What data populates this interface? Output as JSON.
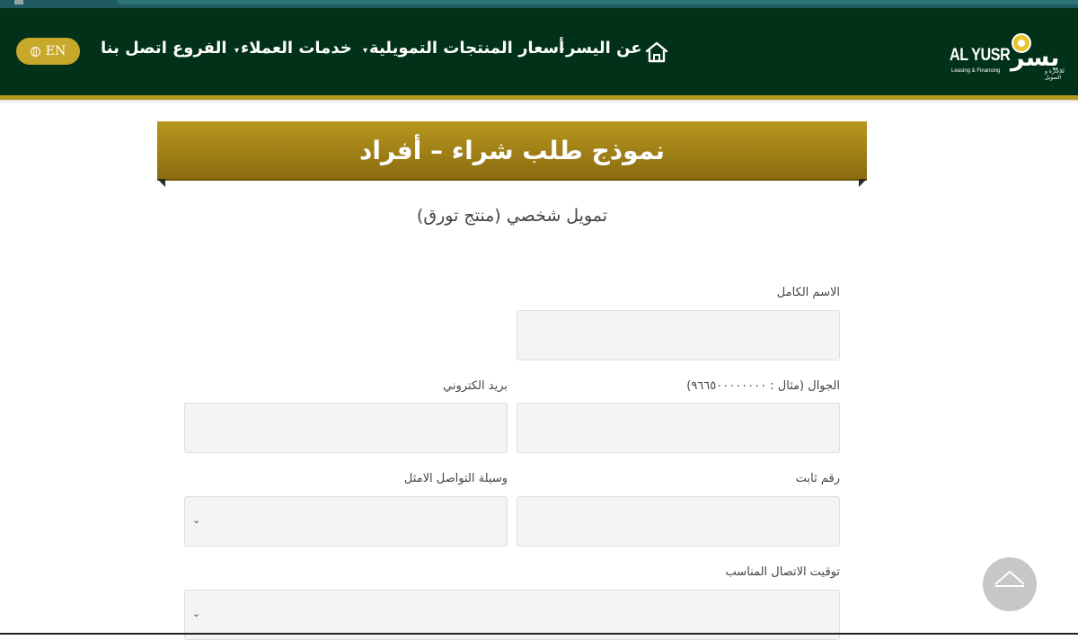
{
  "header": {
    "lang_button": "EN",
    "nav": {
      "about": "عن اليسر",
      "prices": "أسعار المنتجات التمويلية",
      "customer_services": "خدمات العملاء",
      "branches": "الفروع",
      "contact": "اتصل بنا"
    },
    "logo": {
      "en_name": "AL YUSR",
      "en_tagline": "Leasing & Financing",
      "ar_name": "يسر",
      "ar_tagline": "للإجارة و التمويل"
    }
  },
  "page": {
    "title": "نموذج طلب شراء – أفراد",
    "subtitle": "تمويل شخصي (منتج تورق)"
  },
  "form": {
    "full_name_label": "الاسم الكامل",
    "mobile_label": "الجوال (مثال : ٩٦٦٥٠٠٠٠٠٠٠٠)",
    "email_label": "بريد الكتروني",
    "landline_label": "رقم ثابت",
    "contact_method_label": "وسيلة التواصل الامثل",
    "contact_time_label": "توقيت الاتصال المناسب"
  },
  "colors": {
    "header_bg": "#013219",
    "gold": "#b59a1e",
    "banner_top": "#b8961f",
    "banner_bottom": "#8a6c0e"
  }
}
